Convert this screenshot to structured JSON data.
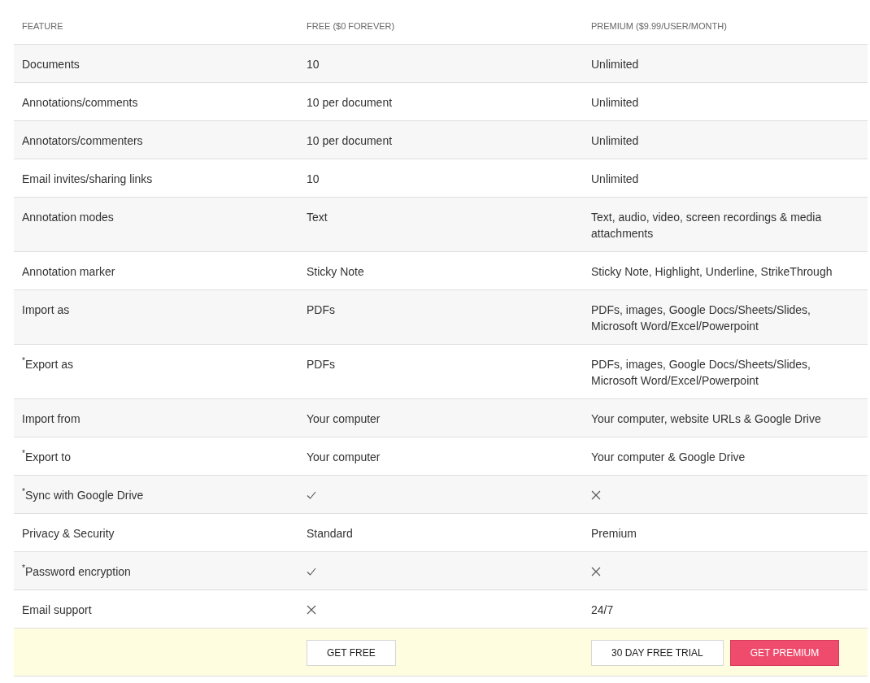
{
  "table": {
    "columns": [
      "FEATURE",
      "FREE ($0 FOREVER)",
      "PREMIUM ($9.99/USER/MONTH)"
    ],
    "rows": [
      {
        "feature": "Documents",
        "free": {
          "kind": "text",
          "text": "10"
        },
        "premium": {
          "kind": "text",
          "text": "Unlimited"
        }
      },
      {
        "feature": "Annotations/comments",
        "free": {
          "kind": "text",
          "text": "10 per document"
        },
        "premium": {
          "kind": "text",
          "text": "Unlimited"
        }
      },
      {
        "feature": "Annotators/commenters",
        "free": {
          "kind": "text",
          "text": "10 per document"
        },
        "premium": {
          "kind": "text",
          "text": "Unlimited"
        }
      },
      {
        "feature": "Email invites/sharing links",
        "free": {
          "kind": "text",
          "text": "10"
        },
        "premium": {
          "kind": "text",
          "text": "Unlimited"
        }
      },
      {
        "feature": "Annotation modes",
        "free": {
          "kind": "text",
          "text": "Text"
        },
        "premium": {
          "kind": "text",
          "text": "Text, audio, video, screen recordings & media attachments"
        }
      },
      {
        "feature": "Annotation marker",
        "free": {
          "kind": "text",
          "text": "Sticky Note"
        },
        "premium": {
          "kind": "text",
          "text": "Sticky Note, Highlight, Underline, StrikeThrough"
        }
      },
      {
        "feature": "Import as",
        "free": {
          "kind": "text",
          "text": "PDFs"
        },
        "premium": {
          "kind": "text",
          "text": "PDFs, images, Google Docs/Sheets/Slides, Microsoft Word/Excel/Powerpoint"
        }
      },
      {
        "feature": "$^{*}$Export as",
        "free": {
          "kind": "text",
          "text": "PDFs"
        },
        "premium": {
          "kind": "text",
          "text": "PDFs, images, Google Docs/Sheets/Slides, Microsoft Word/Excel/Powerpoint"
        }
      },
      {
        "feature": "Import from",
        "free": {
          "kind": "text",
          "text": "Your computer"
        },
        "premium": {
          "kind": "text",
          "text": "Your computer, website URLs & Google Drive"
        }
      },
      {
        "feature": "$^{*}$Export to",
        "free": {
          "kind": "text",
          "text": "Your computer"
        },
        "premium": {
          "kind": "text",
          "text": "Your computer & Google Drive"
        }
      },
      {
        "feature": "$^{*}$Sync with Google Drive",
        "free": {
          "kind": "check"
        },
        "premium": {
          "kind": "cross"
        }
      },
      {
        "feature": "Privacy & Security",
        "free": {
          "kind": "text",
          "text": "Standard"
        },
        "premium": {
          "kind": "text",
          "text": "Premium"
        }
      },
      {
        "feature": "$^{*}$Password encryption",
        "free": {
          "kind": "check"
        },
        "premium": {
          "kind": "cross"
        }
      },
      {
        "feature": "Email support",
        "free": {
          "kind": "cross"
        },
        "premium": {
          "kind": "text",
          "text": "24/7"
        }
      }
    ]
  },
  "footer": {
    "free_buttons": [
      {
        "label": "GET FREE",
        "kind": "outline"
      }
    ],
    "premium_buttons": [
      {
        "label": "30 DAY FREE TRIAL",
        "kind": "outline"
      },
      {
        "label": "GET PREMIUM",
        "kind": "primary"
      }
    ]
  }
}
